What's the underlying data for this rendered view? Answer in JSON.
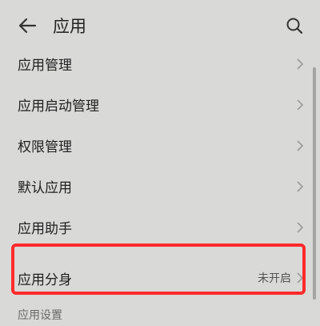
{
  "header": {
    "title": "应用",
    "back_icon": "back-arrow-icon",
    "search_icon": "search-icon"
  },
  "menu": {
    "items": [
      {
        "label": "应用管理"
      },
      {
        "label": "应用启动管理"
      },
      {
        "label": "权限管理"
      },
      {
        "label": "默认应用"
      },
      {
        "label": "应用助手"
      },
      {
        "label": "应用分身",
        "value": "未开启",
        "highlighted": true
      }
    ]
  },
  "section": {
    "header": "应用设置"
  },
  "colors": {
    "background": "#d9d9d7",
    "highlight": "#ff2a2a"
  }
}
